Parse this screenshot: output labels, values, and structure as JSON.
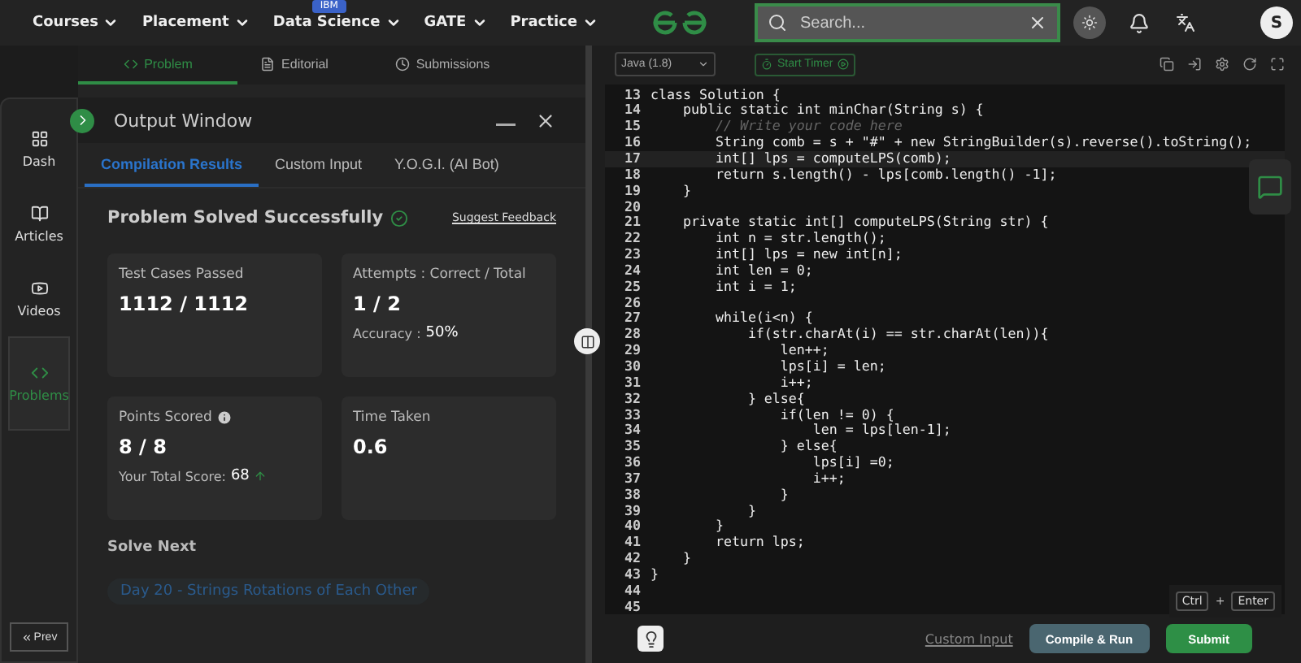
{
  "nav": {
    "items": [
      {
        "label": "Courses"
      },
      {
        "label": "Placement"
      },
      {
        "label": "Data Science",
        "badge": "IBM"
      },
      {
        "label": "GATE"
      },
      {
        "label": "Practice"
      }
    ],
    "search": {
      "placeholder": "Search..."
    },
    "avatar": "S"
  },
  "sidebar": {
    "items": [
      {
        "label": "Dash",
        "selected": false
      },
      {
        "label": "Articles",
        "selected": false
      },
      {
        "label": "Videos",
        "selected": false
      },
      {
        "label": "Problems",
        "selected": true
      }
    ],
    "prev": "Prev"
  },
  "problem_tabs": [
    {
      "label": "Problem",
      "selected": true
    },
    {
      "label": "Editorial",
      "selected": false
    },
    {
      "label": "Submissions",
      "selected": false
    }
  ],
  "output": {
    "title": "Output Window",
    "tabs": [
      {
        "label": "Compilation Results",
        "selected": true
      },
      {
        "label": "Custom Input",
        "selected": false
      },
      {
        "label": "Y.O.G.I. (AI Bot)",
        "selected": false
      }
    ],
    "status": "Problem Solved Successfully",
    "feedback": "Suggest Feedback",
    "cards": [
      {
        "label": "Test Cases Passed",
        "value": "1112 / 1112",
        "info": false
      },
      {
        "label": "Attempts : Correct / Total",
        "value": "1 / 2",
        "note_label": "Accuracy :",
        "note_value": "50%",
        "info": false
      },
      {
        "label": "Points Scored",
        "value": "8 / 8",
        "note_label": "Your Total Score:",
        "note_value": "68",
        "info": true
      },
      {
        "label": "Time Taken",
        "value": "0.6",
        "info": false
      }
    ],
    "solve_next": "Solve Next",
    "next_problem": "Day 20 - Strings Rotations of Each Other"
  },
  "editor": {
    "language": "Java (1.8)",
    "timer": "Start Timer",
    "lines": [
      {
        "n": "13",
        "text": "class Solution {",
        "kind": "code"
      },
      {
        "n": "14",
        "text": "    public static int minChar(String s) {",
        "kind": "code"
      },
      {
        "n": "15",
        "text": "        // Write your code here",
        "kind": "comment"
      },
      {
        "n": "16",
        "text": "        String comb = s + \"#\" + new StringBuilder(s).reverse().toString();",
        "kind": "code"
      },
      {
        "n": "17",
        "text": "        int[] lps = computeLPS(comb);",
        "kind": "code"
      },
      {
        "n": "18",
        "text": "        return s.length() - lps[comb.length() -1];",
        "kind": "code"
      },
      {
        "n": "19",
        "text": "    }",
        "kind": "code"
      },
      {
        "n": "20",
        "kind": "code"
      },
      {
        "n": "21",
        "text": "    private static int[] computeLPS(String str) {",
        "kind": "code"
      },
      {
        "n": "22",
        "text": "        int n = str.length();",
        "kind": "code"
      },
      {
        "n": "23",
        "text": "        int[] lps = new int[n];",
        "kind": "code"
      },
      {
        "n": "24",
        "text": "        int len = 0;",
        "kind": "code"
      },
      {
        "n": "25",
        "text": "        int i = 1;",
        "kind": "code"
      },
      {
        "n": "26",
        "kind": "code"
      },
      {
        "n": "27",
        "text": "        while(i<n) {",
        "kind": "code"
      },
      {
        "n": "28",
        "text": "            if(str.charAt(i) == str.charAt(len)){",
        "kind": "code"
      },
      {
        "n": "29",
        "text": "                len++;",
        "kind": "code"
      },
      {
        "n": "30",
        "text": "                lps[i] = len;",
        "kind": "code"
      },
      {
        "n": "31",
        "text": "                i++;",
        "kind": "code"
      },
      {
        "n": "32",
        "text": "            } else{",
        "kind": "code"
      },
      {
        "n": "33",
        "text": "                if(len != 0) {",
        "kind": "code"
      },
      {
        "n": "34",
        "text": "                    len = lps[len-1];",
        "kind": "code"
      },
      {
        "n": "35",
        "text": "                } else{",
        "kind": "code"
      },
      {
        "n": "36",
        "text": "                    lps[i] =0;",
        "kind": "code"
      },
      {
        "n": "37",
        "text": "                    i++;",
        "kind": "code"
      },
      {
        "n": "38",
        "text": "                }",
        "kind": "code"
      },
      {
        "n": "39",
        "text": "            }",
        "kind": "code"
      },
      {
        "n": "40",
        "text": "        }",
        "kind": "code"
      },
      {
        "n": "41",
        "text": "        return lps;",
        "kind": "code"
      },
      {
        "n": "42",
        "text": "    }",
        "kind": "code"
      },
      {
        "n": "43",
        "text": "}",
        "kind": "code"
      },
      {
        "n": "44",
        "kind": "code"
      },
      {
        "n": "45",
        "kind": "code"
      }
    ],
    "keys": [
      "Ctrl",
      "+",
      "Enter"
    ],
    "custom_input": "Custom Input",
    "compile": "Compile & Run",
    "submit": "Submit"
  }
}
